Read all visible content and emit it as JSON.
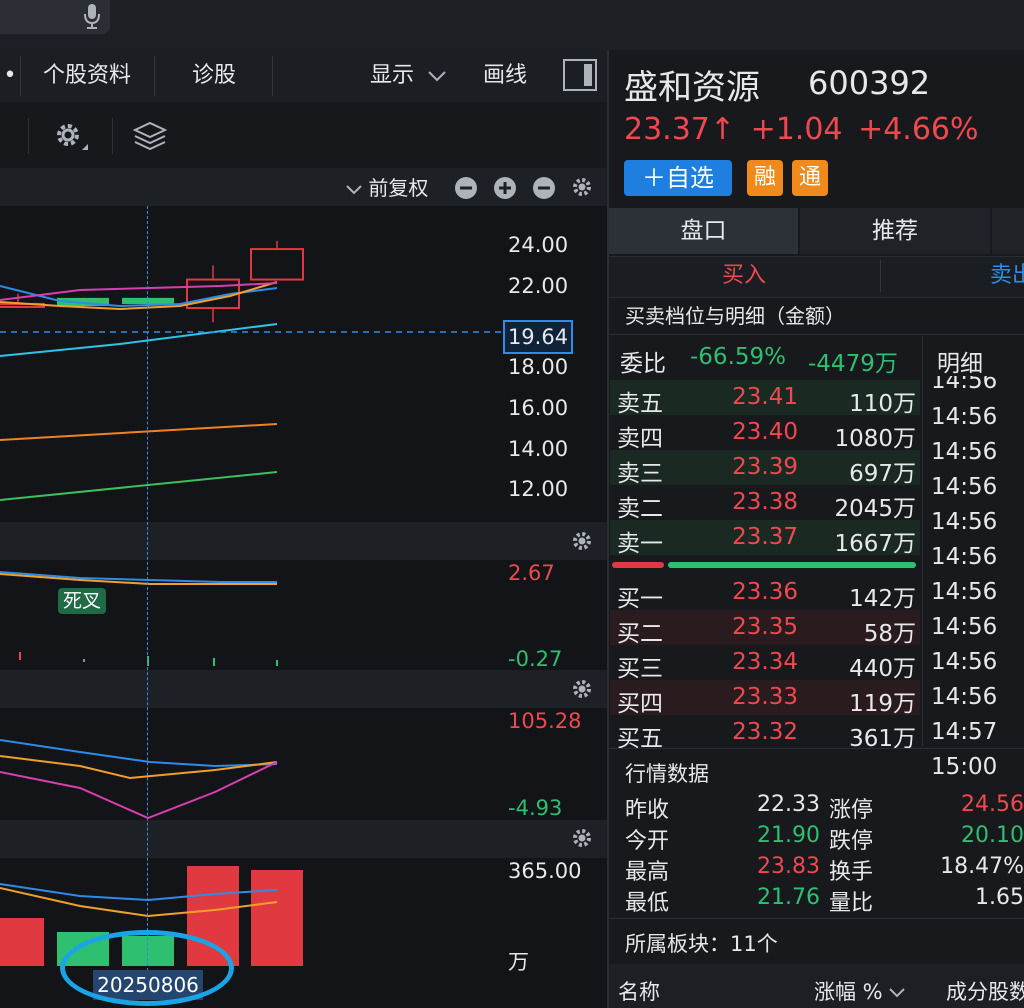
{
  "tabs": {
    "dot": "•",
    "stock_info": "个股资料",
    "diagnose": "诊股",
    "display": "显示",
    "draw": "画线"
  },
  "chart_toolbar": {
    "adjust": "前复权"
  },
  "main_chart": {
    "y_labels": [
      "24.00",
      "22.00",
      "18.00",
      "16.00",
      "14.00",
      "12.00"
    ],
    "crosshair_price": "19.64",
    "crosshair_date": "20250806"
  },
  "macd_pane": {
    "top_value": "2.67",
    "bottom_value": "-0.27",
    "signal_tag": "死叉"
  },
  "kdj_pane": {
    "top_value": "105.28",
    "bottom_value": "-4.93"
  },
  "volume_pane": {
    "top_value": "365.00",
    "unit": "万"
  },
  "chart_data": {
    "type": "candlestick",
    "y_axis_ticks": [
      12,
      14,
      16,
      18,
      22,
      24
    ],
    "candles": [
      {
        "open": 21.0,
        "close": 21.1,
        "high": 21.6,
        "low": 20.9,
        "direction": "up"
      },
      {
        "open": 21.4,
        "close": 21.0,
        "high": 21.4,
        "low": 20.9,
        "direction": "down"
      },
      {
        "open": 21.4,
        "close": 21.1,
        "high": 21.4,
        "low": 20.9,
        "direction": "down"
      },
      {
        "open": 20.9,
        "close": 22.3,
        "high": 23.0,
        "low": 20.2,
        "direction": "up"
      },
      {
        "open": 22.3,
        "close": 23.8,
        "high": 24.2,
        "low": 22.3,
        "direction": "up"
      }
    ],
    "volume_direction": [
      "up",
      "down",
      "down",
      "up",
      "up"
    ]
  },
  "stock": {
    "name": "盛和资源",
    "code": "600392",
    "price": "23.37",
    "arrow": "↑",
    "change": "+1.04",
    "change_pct": "+4.66%",
    "add_watch": "＋自选",
    "tag_margin": "融",
    "tag_connect": "通"
  },
  "right_tabs": {
    "quote": "盘口",
    "recommend": "推荐",
    "buy": "买入",
    "sell": "卖出"
  },
  "order_book": {
    "section_title": "买卖档位与明细（金额）",
    "ratio_label": "委比",
    "ratio_pct": "-66.59%",
    "ratio_amt": "-4479万",
    "detail_label": "明细",
    "asks": [
      {
        "label": "卖五",
        "price": "23.41",
        "amount": "110万"
      },
      {
        "label": "卖四",
        "price": "23.40",
        "amount": "1080万"
      },
      {
        "label": "卖三",
        "price": "23.39",
        "amount": "697万"
      },
      {
        "label": "卖二",
        "price": "23.38",
        "amount": "2045万"
      },
      {
        "label": "卖一",
        "price": "23.37",
        "amount": "1667万"
      }
    ],
    "bids": [
      {
        "label": "买一",
        "price": "23.36",
        "amount": "142万"
      },
      {
        "label": "买二",
        "price": "23.35",
        "amount": "58万"
      },
      {
        "label": "买三",
        "price": "23.34",
        "amount": "440万"
      },
      {
        "label": "买四",
        "price": "23.33",
        "amount": "119万"
      },
      {
        "label": "买五",
        "price": "23.32",
        "amount": "361万"
      }
    ],
    "times": [
      "14:56",
      "14:56",
      "14:56",
      "14:56",
      "14:56",
      "14:56",
      "14:56",
      "14:56",
      "14:56",
      "14:56",
      "14:57",
      "15:00"
    ]
  },
  "market_data": {
    "title": "行情数据",
    "rows": [
      {
        "l1": "昨收",
        "v1": "22.33",
        "l2": "涨停",
        "v2": "24.56"
      },
      {
        "l1": "今开",
        "v1": "21.90",
        "l2": "跌停",
        "v2": "20.10"
      },
      {
        "l1": "最高",
        "v1": "23.83",
        "l2": "换手",
        "v2": "18.47%"
      },
      {
        "l1": "最低",
        "v1": "21.76",
        "l2": "量比",
        "v2": "1.65"
      }
    ]
  },
  "sectors": {
    "title": "所属板块：11个",
    "col_name": "名称",
    "col_change": "涨幅 %",
    "col_members": "成分股数"
  }
}
